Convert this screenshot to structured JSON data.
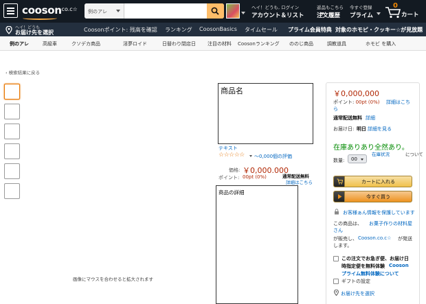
{
  "header": {
    "logo": "cooson",
    "logo_suffix": ".co.c☆",
    "search_category": "例のアレ",
    "search_placeholder": "",
    "account_line1": "ヘイ！どうも, ログイン",
    "account_line2": "アカウント＆リスト",
    "orders_line1": "返品もこちら",
    "orders_line2": "注文履歴",
    "prime_line1": "今すぐ登録",
    "prime_line2": "プライム",
    "cart_count": "0",
    "cart_label": "カート"
  },
  "subnav": {
    "deliver_line1": "ヘイ！どうも",
    "deliver_line2": "お届け先を選択",
    "links": [
      "Coosonポイント: 残高を確認",
      "ランキング",
      "CoosonBasics",
      "タイムセール"
    ],
    "bold_links": [
      "プライム会員特典",
      "対象のホモピ・クッキー☆が見放題"
    ]
  },
  "categories": [
    "例のアレ",
    "高級車",
    "クソデカ商品",
    "淫夢ロイド",
    "日替わり閉店日",
    "注目の材料",
    "Coosonランキング",
    "ののじ商品",
    "調教道具",
    "ホモビ を購入"
  ],
  "breadcrumb": "‹ 検索結果に戻る",
  "gallery": {
    "zoom_hint": "画像にマウスを合わせると拡大されます"
  },
  "product": {
    "title": "商品名",
    "brand": "テキスト",
    "stars": "☆☆☆☆☆",
    "rating": 0,
    "review_count": "〜0,000個の評価",
    "price_label": "価格:",
    "price": "￥0,000.000",
    "point_label": "ポイント:",
    "point_value": "00pt  (0%)",
    "shipping_free": "通常配送無料",
    "shipping_detail": "詳細はこちら",
    "details_title": "商品の詳細"
  },
  "buybox": {
    "price": "￥0,000,000",
    "point_text": "ポイント:",
    "point_value": "00pt  (0%)",
    "point_link1": "詳細はこち",
    "point_link2": "ら",
    "shipping": "通常配送無料",
    "shipping_link": "詳細",
    "delivery_label": "お届け日:",
    "delivery_day": "明日",
    "delivery_link": "詳細を見る",
    "stock": "在庫ありあり全然あり。",
    "stock_link": "在庫状況",
    "stock_suffix": "について",
    "qty_label": "数量:",
    "qty_value": "00",
    "add_to_cart": "カートに入れる",
    "buy_now": "今すぐ買う",
    "secure": "お客様ぁん情報を保護しています",
    "seller_text": "この商品は、",
    "seller_link1": "お菓子作りの材料屋",
    "seller_link2": "さん",
    "sold_text": "が販売し、",
    "sold_link": "Cooson.co.c☆",
    "sold_suffix": "が発送",
    "sold_end": "します。",
    "gift_head1": "この注文でお急ぎ便、お届け日",
    "gift_head2": "時指定便を無料体験",
    "gift_link1": "Cooson",
    "gift_link2": "プライム無料体験について",
    "gift_option": "ギフトの設定",
    "address_link": "お届け先を選択"
  },
  "colors": {
    "header_bg": "#131a22",
    "subnav_bg": "#232f3e",
    "search_button": "#febd69",
    "price_red": "#b12704",
    "link_blue": "#0066c0",
    "stock_green": "#008a00",
    "cart_button": "#f0c14b",
    "buy_button": "#ed9220"
  }
}
